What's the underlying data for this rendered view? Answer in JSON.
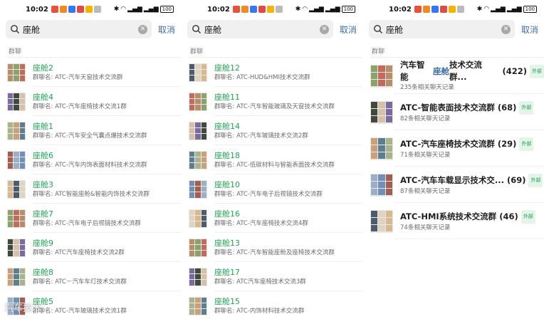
{
  "status": {
    "time": "10:02",
    "battery": "100"
  },
  "search": {
    "query": "座舱",
    "cancel": "取消"
  },
  "section": "群聊",
  "sub_prefix": "群聊名: ",
  "colors": {
    "highlight": "#20a354",
    "link": "#3b6ea5",
    "tag_bg": "#e4f4e9"
  },
  "panel1": [
    {
      "num": "2",
      "name": "ATC-汽车天窗技术交流群"
    },
    {
      "num": "4",
      "name": "ATC-汽车座椅技术交流1群"
    },
    {
      "num": "1",
      "name": "ATC-汽车安全气囊点爆技术交流群"
    },
    {
      "num": "6",
      "name": "ATC-汽车内饰表面材料技术交流群"
    },
    {
      "num": "3",
      "name": "ATC智能座舱&智能内饰技术交流群"
    },
    {
      "num": "7",
      "name": "ATC-汽车电子后视镜技术交流群"
    },
    {
      "num": "9",
      "name": "ATC汽车座椅技术交流2群"
    },
    {
      "num": "8",
      "name": "ATC－汽车车灯技术交流群"
    },
    {
      "num": "5",
      "name": "ATC-汽车玻璃技术交流1群"
    }
  ],
  "panel2": [
    {
      "num": "12",
      "name": "ATC-HUD&HMI技术交流群"
    },
    {
      "num": "11",
      "name": "ATC-汽车智能玻璃及天窗技术交流群"
    },
    {
      "num": "14",
      "name": "ATC-汽车玻璃技术交流2群"
    },
    {
      "num": "18",
      "name": "ATC-低碳材料与智能表面技术交流群"
    },
    {
      "num": "10",
      "name": "ATC-汽车电子后视镜技术交流群"
    },
    {
      "num": "16",
      "name": "ATC-汽车座椅技术交流4群"
    },
    {
      "num": "13",
      "name": "ATC-汽车智能座舱及座椅技术交流群"
    },
    {
      "num": "17",
      "name": "ATC汽车座椅技术交流3群"
    },
    {
      "num": "15",
      "name": "ATC-内饰材料技术交流群"
    }
  ],
  "panel3": [
    {
      "title_a": "汽车智能",
      "title_hl": "座舱",
      "title_b": "技术交流群...",
      "count": "(422)",
      "tag": "外部",
      "sub": "235条相关聊天记录"
    },
    {
      "title_a": "ATC-智能表面技术交流群",
      "title_hl": "",
      "title_b": "",
      "count": "(68)",
      "tag": "外部",
      "sub": "82条相关聊天记录"
    },
    {
      "title_a": "ATC-汽车座椅技术交流群",
      "title_hl": "",
      "title_b": "",
      "count": "(29)",
      "tag": "外部",
      "sub": "71条相关聊天记录"
    },
    {
      "title_a": "ATC-汽车车载显示技术交...",
      "title_hl": "",
      "title_b": "",
      "count": "(69)",
      "tag": "外部",
      "sub": "87条相关聊天记录"
    },
    {
      "title_a": "ATC-HMI系统技术交流群",
      "title_hl": "",
      "title_b": "",
      "count": "(46)",
      "tag": "外部",
      "sub": "74条相关聊天记录"
    }
  ],
  "watermark": "汽车技术"
}
